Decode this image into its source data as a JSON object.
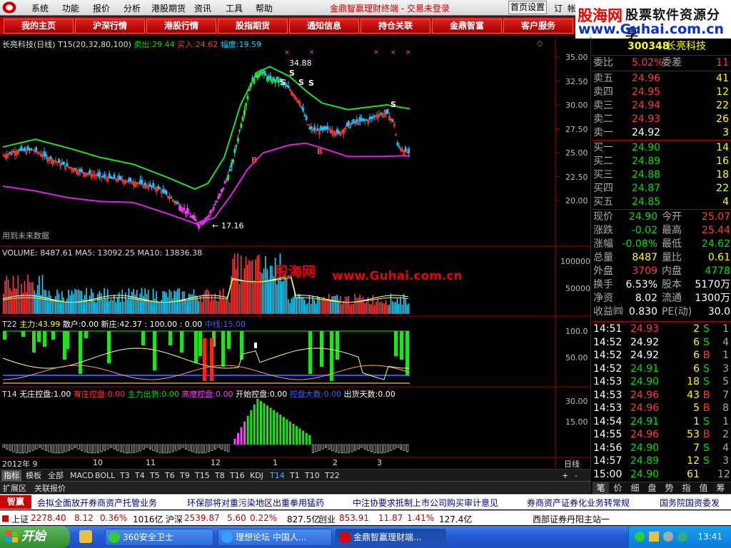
{
  "menubar": {
    "items": [
      "系统",
      "功能",
      "报价",
      "分析",
      "港股期货",
      "资讯",
      "工具",
      "帮助"
    ],
    "title": "金鼎智赢理财终端 - 交易未登录",
    "home_settings": "首页设置",
    "ctl1": "订",
    "ctl2": "帐"
  },
  "navbar": {
    "items": [
      "我的主页",
      "沪深行情",
      "港股行情",
      "股指期货",
      "通知信息",
      "持仓关联",
      "金鼎智富",
      "客户服务"
    ]
  },
  "brand": {
    "name": "股海网",
    "slogan": "股票软件资源分享",
    "url": "www.Guhai.com.cn"
  },
  "chart": {
    "header": {
      "name": "长亮科技(日线)",
      "indicator": "T15(20,32,80,100)",
      "sell_label": "卖出:",
      "sell_val": "29.44",
      "buy_label": "买入:",
      "buy_val": "24.62",
      "amp_label": "幅度:",
      "amp_val": "19.59"
    },
    "price_axis": [
      "35.00",
      "32.50",
      "30.00",
      "27.50",
      "25.00",
      "22.50",
      "20.00"
    ],
    "high_label": "34.88",
    "low_label": "17.16",
    "future_note": "用到未来数据",
    "s_marks": [
      "S",
      "S",
      "S",
      "S",
      "S"
    ],
    "b_marks": [
      "B",
      "B"
    ],
    "watermark_cn": "股海网",
    "watermark_url": "www.Guhai.com.cn",
    "volume": {
      "header_vol": "VOLUME: 8487.61",
      "ma5": "MA5: 13092.25",
      "ma10": "MA10: 13836.38",
      "axis": [
        "100000",
        "50000"
      ]
    },
    "t22": {
      "title": "T22",
      "main_label": "主力:",
      "main_val": "43.99",
      "retail_label": "散户:",
      "retail_val": "0.00",
      "new_label": "新庄:",
      "new_val": "42.37",
      "v1": ": 100.00",
      "v2": ": 0.00",
      "mid_label": "中线:",
      "mid_val": "15.00",
      "axis": [
        "100.0",
        "50.00"
      ]
    },
    "t14": {
      "title": "T14",
      "items": [
        {
          "label": "无庄控盘:",
          "val": "1.00"
        },
        {
          "label": "有庄控盘:",
          "val": "0.00"
        },
        {
          "label": "主力出货:",
          "val": "0.00"
        },
        {
          "label": "高度控盘:",
          "val": "0.00"
        },
        {
          "label": "开始控盘:",
          "val": "0.00"
        },
        {
          "label": "控盘大数:",
          "val": "0.00"
        },
        {
          "label": "出货天数:",
          "val": "0.00"
        }
      ],
      "axis": [
        "30.00",
        "15.00"
      ]
    },
    "date_axis": [
      "2012年 9",
      "10",
      "11",
      "12",
      "1",
      "2",
      "3"
    ],
    "period": "日线"
  },
  "tabs": [
    "指标",
    "模板",
    "全部",
    "MACD",
    "BOLL",
    "T3",
    "T4",
    "T5",
    "T6",
    "T9",
    "T15",
    "T8",
    "T16",
    "KDJ",
    "T14",
    "T1",
    "T10",
    "T22"
  ],
  "tab_ctl": [
    "+",
    "-"
  ],
  "extabs": [
    "扩展区",
    "关联报价"
  ],
  "quote": {
    "code": "300348",
    "name": "长亮科技",
    "wb_label": "委比",
    "wb_val": "5.02%",
    "wc_label": "委差",
    "wc_val": "11",
    "asks": [
      {
        "label": "卖五",
        "price": "24.96",
        "vol": "41"
      },
      {
        "label": "卖四",
        "price": "24.95",
        "vol": "12"
      },
      {
        "label": "卖三",
        "price": "24.94",
        "vol": "22"
      },
      {
        "label": "卖二",
        "price": "24.93",
        "vol": "26"
      },
      {
        "label": "卖一",
        "price": "24.92",
        "vol": "3"
      }
    ],
    "bids": [
      {
        "label": "买一",
        "price": "24.90",
        "vol": "14"
      },
      {
        "label": "买二",
        "price": "24.89",
        "vol": "16"
      },
      {
        "label": "买三",
        "price": "24.88",
        "vol": "18"
      },
      {
        "label": "买四",
        "price": "24.87",
        "vol": "22"
      },
      {
        "label": "买五",
        "price": "24.85",
        "vol": "4"
      }
    ],
    "stats": [
      {
        "l1": "现价",
        "v1": "24.90",
        "c1": "grn",
        "l2": "今开",
        "v2": "25.07",
        "c2": "red"
      },
      {
        "l1": "涨跌",
        "v1": "-0.02",
        "c1": "grn",
        "l2": "最高",
        "v2": "25.44",
        "c2": "red"
      },
      {
        "l1": "涨幅",
        "v1": "-0.08%",
        "c1": "grn",
        "l2": "最低",
        "v2": "24.62",
        "c2": "grn"
      },
      {
        "l1": "总量",
        "v1": "8487",
        "c1": "yel",
        "l2": "量比",
        "v2": "0.61",
        "c2": "yel"
      },
      {
        "l1": "外盘",
        "v1": "3709",
        "c1": "red",
        "l2": "内盘",
        "v2": "4778",
        "c2": "grn"
      },
      {
        "l1": "换手",
        "v1": "6.53%",
        "c1": "wht",
        "l2": "股本",
        "v2": "5170万",
        "c2": "wht"
      },
      {
        "l1": "净资",
        "v1": "8.02",
        "c1": "wht",
        "l2": "流通",
        "v2": "1300万",
        "c2": "wht"
      },
      {
        "l1": "收益㈣",
        "v1": "0.830",
        "c1": "wht",
        "l2": "PE(动)",
        "v2": "30.0",
        "c2": "wht"
      }
    ],
    "ticks": [
      {
        "t": "14:51",
        "p": "24.93",
        "pc": "red",
        "v": "2",
        "s": "S"
      },
      {
        "t": "14:52",
        "p": "24.92",
        "pc": "wht",
        "v": "6",
        "s": "S"
      },
      {
        "t": "14:52",
        "p": "24.92",
        "pc": "wht",
        "v": "6",
        "s": "B"
      },
      {
        "t": "14:52",
        "p": "24.91",
        "pc": "grn",
        "v": "6",
        "s": "S"
      },
      {
        "t": "14:53",
        "p": "24.90",
        "pc": "grn",
        "v": "18",
        "s": "S"
      },
      {
        "t": "14:53",
        "p": "24.96",
        "pc": "red",
        "v": "43",
        "s": "B"
      },
      {
        "t": "14:53",
        "p": "24.96",
        "pc": "red",
        "v": "5",
        "s": "B"
      },
      {
        "t": "14:54",
        "p": "24.91",
        "pc": "grn",
        "v": "1",
        "s": "S"
      },
      {
        "t": "14:55",
        "p": "24.96",
        "pc": "red",
        "v": "53",
        "s": "B"
      },
      {
        "t": "14:56",
        "p": "24.90",
        "pc": "grn",
        "v": "7",
        "s": "S"
      },
      {
        "t": "14:57",
        "p": "24.89",
        "pc": "grn",
        "v": "12",
        "s": "S"
      },
      {
        "t": "15:00",
        "p": "24.90",
        "pc": "grn",
        "v": "61",
        "s": ""
      }
    ],
    "tick_extra": [
      "1",
      "4",
      "1",
      "3",
      "5",
      "7",
      "8",
      "1",
      "2",
      "4",
      "3",
      "12"
    ],
    "panel_tabs": [
      "笔",
      "价",
      "细",
      "盘",
      "势",
      "指",
      "值",
      "筹"
    ]
  },
  "ticker": {
    "logo": "智赢",
    "news": [
      "会拟全面放开券商资产托管业务",
      "环保部将对重污染地区出重拳用猛药",
      "中注协要求抵制上市公司购买审计意见",
      "券商资产证券化业务转常规",
      "国务院国资委发"
    ]
  },
  "indices": {
    "sh_label": "上证",
    "sh_val": "2278.40",
    "sh_chg": "8.12",
    "sh_pct": "0.36%",
    "sh_amt": "1016亿",
    "sz_label": "沪深",
    "sz_val": "2539.87",
    "sz_chg": "5.60",
    "sz_pct": "0.22%",
    "sz_amt": "827.5亿",
    "cy_label": "创业",
    "cy_val": "853.91",
    "cy_chg": "11.87",
    "cy_pct": "1.41%",
    "cy_amt": "127.4亿",
    "broker": "西部证券丹阳主站一"
  },
  "taskbar": {
    "start": "开始",
    "items": [
      "360安全卫士",
      "理想论坛 中国人...",
      "金鼎智赢理财端..."
    ],
    "clock": "13:41"
  }
}
